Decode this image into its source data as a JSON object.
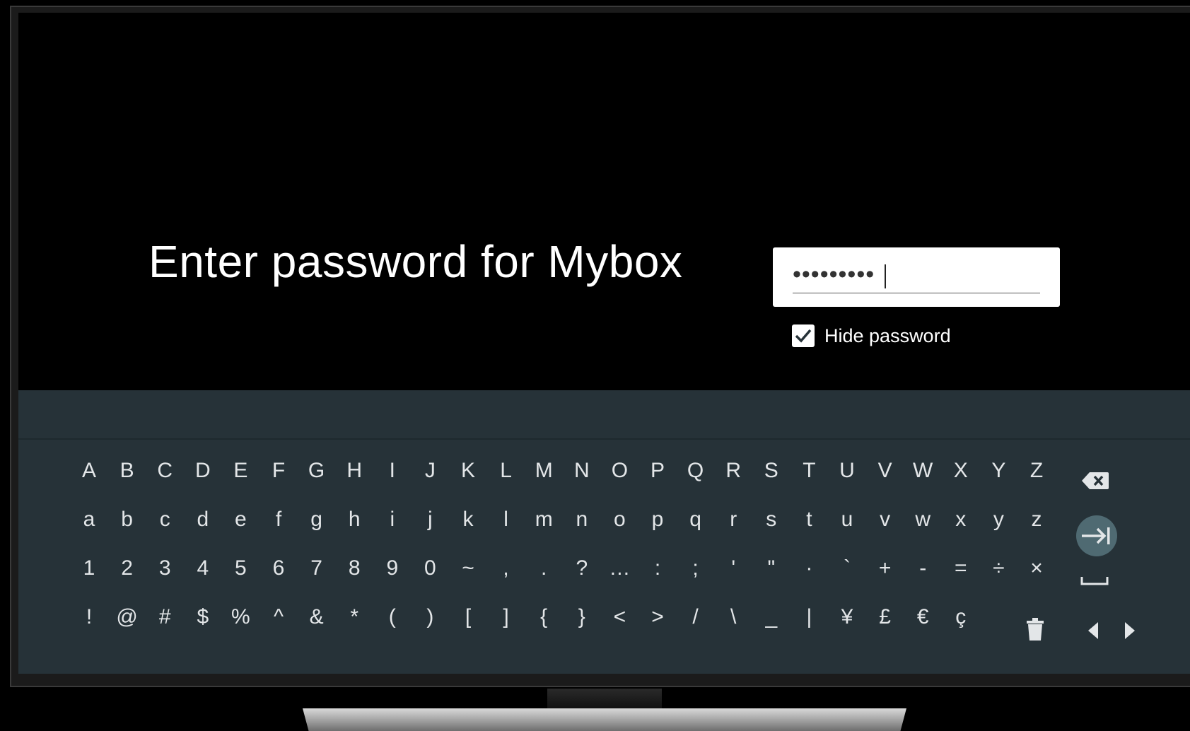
{
  "prompt": {
    "title": "Enter password for Mybox"
  },
  "password_field": {
    "masked_value": "•••••••••"
  },
  "hide_password": {
    "label": "Hide password",
    "checked": true
  },
  "keyboard": {
    "rows": [
      [
        "A",
        "B",
        "C",
        "D",
        "E",
        "F",
        "G",
        "H",
        "I",
        "J",
        "K",
        "L",
        "M",
        "N",
        "O",
        "P",
        "Q",
        "R",
        "S",
        "T",
        "U",
        "V",
        "W",
        "X",
        "Y",
        "Z"
      ],
      [
        "a",
        "b",
        "c",
        "d",
        "e",
        "f",
        "g",
        "h",
        "i",
        "j",
        "k",
        "l",
        "m",
        "n",
        "o",
        "p",
        "q",
        "r",
        "s",
        "t",
        "u",
        "v",
        "w",
        "x",
        "y",
        "z"
      ],
      [
        "1",
        "2",
        "3",
        "4",
        "5",
        "6",
        "7",
        "8",
        "9",
        "0",
        "~",
        ",",
        ".",
        "?",
        "…",
        ":",
        ";",
        "'",
        "\"",
        "·",
        "`",
        "+",
        "-",
        "=",
        "÷",
        "×"
      ],
      [
        "!",
        "@",
        "#",
        "$",
        "%",
        "^",
        "&",
        "*",
        "(",
        ")",
        "[",
        "]",
        "{",
        "}",
        "<",
        ">",
        "/",
        "\\",
        "_",
        "|",
        "¥",
        "£",
        "€",
        "ç"
      ]
    ],
    "function_keys": [
      {
        "name": "backspace-key",
        "icon": "backspace-icon"
      },
      {
        "name": "enter-next-key",
        "icon": "tab-arrow-icon",
        "highlight_color": "#4f6a72"
      },
      {
        "name": "space-key",
        "icon": "space-bar-icon"
      },
      {
        "name": "clear-key",
        "icon": "trash-icon"
      },
      {
        "name": "cursor-left-key",
        "icon": "triangle-left-icon"
      },
      {
        "name": "cursor-right-key",
        "icon": "triangle-right-icon"
      }
    ]
  },
  "colors": {
    "screen_background": "#000000",
    "keyboard_background": "#263238",
    "text": "#ffffff",
    "key_text": "#e3e6e8",
    "focus_highlight": "#4f6a72"
  }
}
